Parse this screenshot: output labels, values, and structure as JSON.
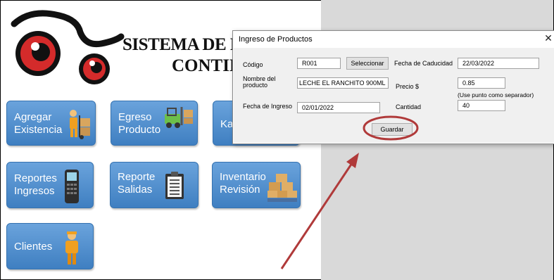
{
  "app": {
    "title_line1": "SISTEMA DE R",
    "title_line2": "CONTIN"
  },
  "tiles": {
    "agregar": "Agregar\nExistencia",
    "egreso": "Egreso\nProducto",
    "kardex": "Ka",
    "reportes_ingresos": "Reportes\nIngresos",
    "reporte_salidas": "Reporte\nSalidas",
    "inventario": "Inventario\nRevisión",
    "clientes": "Clientes"
  },
  "dialog": {
    "title": "Ingreso de Productos",
    "close": "✕",
    "codigo_label": "Código",
    "codigo_value": "R001",
    "seleccionar_label": "Seleccionar",
    "fecha_caducidad_label": "Fecha de Caducidad",
    "fecha_caducidad_value": "22/03/2022",
    "nombre_label": "Nombre del\nproducto",
    "nombre_value": "LECHE EL RANCHITO 900ML",
    "precio_label": "Precio  $",
    "precio_value": "0.85",
    "precio_hint": "(Use punto como separador)",
    "fecha_ingreso_label": "Fecha de Ingreso",
    "fecha_ingreso_value": "02/01/2022",
    "cantidad_label": "Cantidad",
    "cantidad_value": "40",
    "guardar_label": "Guardar"
  },
  "colors": {
    "tile": "#4a8bcf",
    "annotation": "#b03a3a",
    "grey_area": "#d9d9d9"
  }
}
